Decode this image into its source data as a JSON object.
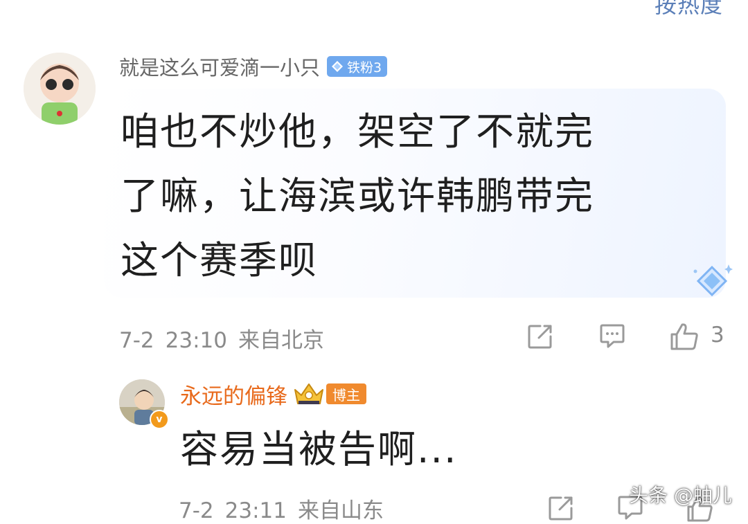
{
  "header": {
    "sort_label": "按热度"
  },
  "main_comment": {
    "username": "就是这么可爱滴一小只",
    "fan_badge": "铁粉3",
    "text_lines": [
      "咱也不炒他，架空了不就完",
      "了嘛，让海滨或许韩鹏带完",
      "这个赛季呗"
    ],
    "date": "7-2",
    "time": "23:10",
    "location": "来自北京",
    "like_count": "3",
    "icons": [
      "avatar",
      "fan-badge-diamond-icon",
      "bubble-diamond-icon",
      "share-icon",
      "comment-icon",
      "like-icon"
    ]
  },
  "reply": {
    "username": "永远的偏锋",
    "author_badge": "博主",
    "verify_mark": "v",
    "text": "容易当被告啊...",
    "date": "7-2",
    "time": "23:11",
    "location": "来自山东",
    "icons": [
      "avatar",
      "crown-icon",
      "share-icon",
      "comment-icon",
      "like-icon"
    ]
  },
  "watermark": "头条 @蚰儿",
  "colors": {
    "meta_gray": "#8a8a8a",
    "reply_name": "#e86a1c",
    "author_badge_bg": "#f08a2e",
    "fan_badge_bg": "#6fa8ee",
    "icon_gray": "#9a9a9a"
  }
}
